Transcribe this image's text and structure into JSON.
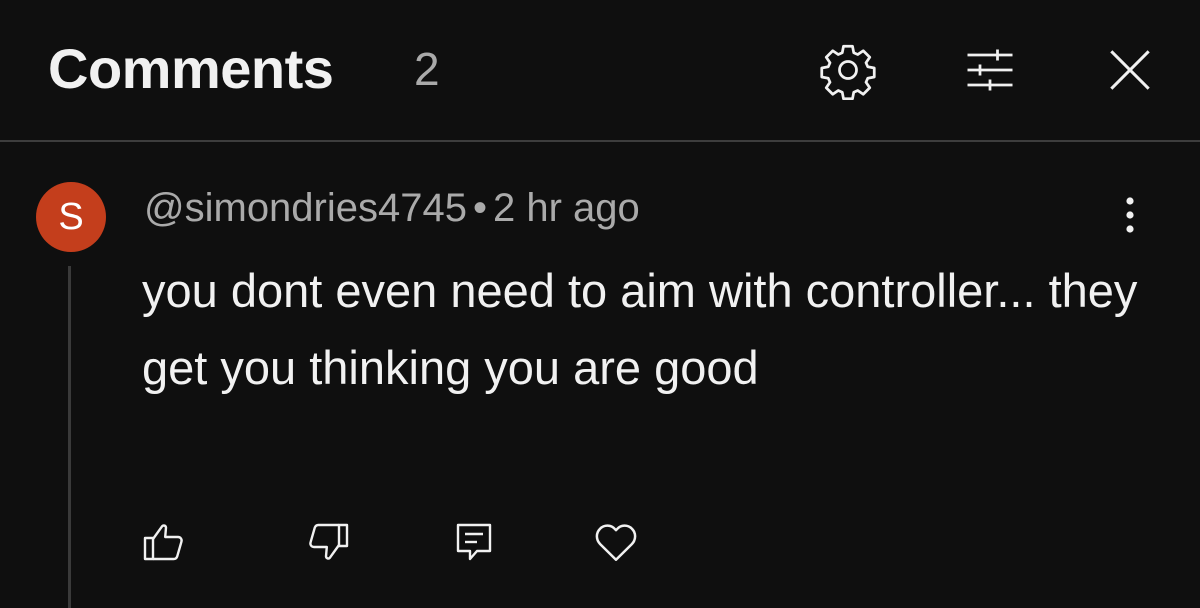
{
  "header": {
    "title": "Comments",
    "count": "2",
    "icons": [
      "gear-icon",
      "filter-sliders-icon",
      "close-icon"
    ]
  },
  "comment": {
    "avatar_letter": "S",
    "avatar_color": "#c43e1c",
    "author": "@simondries4745",
    "separator": "•",
    "time": "2 hr ago",
    "text": "you dont even need to aim with controller... they get you thinking you are good",
    "actions": [
      "thumbs-up-icon",
      "thumbs-down-icon",
      "reply-icon",
      "heart-icon"
    ],
    "menu_icon": "more-vert-icon"
  },
  "colors": {
    "background": "#0f0f0f",
    "primary_text": "#f1f1f1",
    "secondary_text": "#aaaaaa",
    "divider": "#3d3d3d"
  }
}
